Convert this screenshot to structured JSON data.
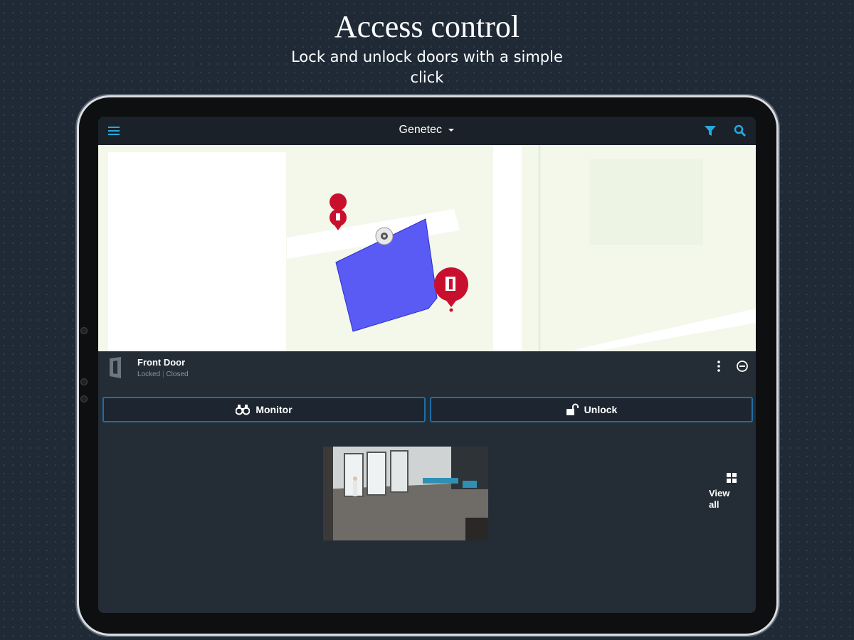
{
  "promo": {
    "title": "Access control",
    "subtitle": "Lock and unlock doors with a simple click"
  },
  "app": {
    "title": "Genetec",
    "accent_color": "#29a8e0",
    "brand_pin_color": "#c8102e"
  },
  "map": {
    "area_color": "#5a5af5"
  },
  "door": {
    "name": "Front Door",
    "status_locked": "Locked",
    "status_separator": "|",
    "status_closed": "Closed"
  },
  "actions": {
    "monitor_label": "Monitor",
    "unlock_label": "Unlock"
  },
  "cameras": {
    "view_all_label": "View all"
  }
}
